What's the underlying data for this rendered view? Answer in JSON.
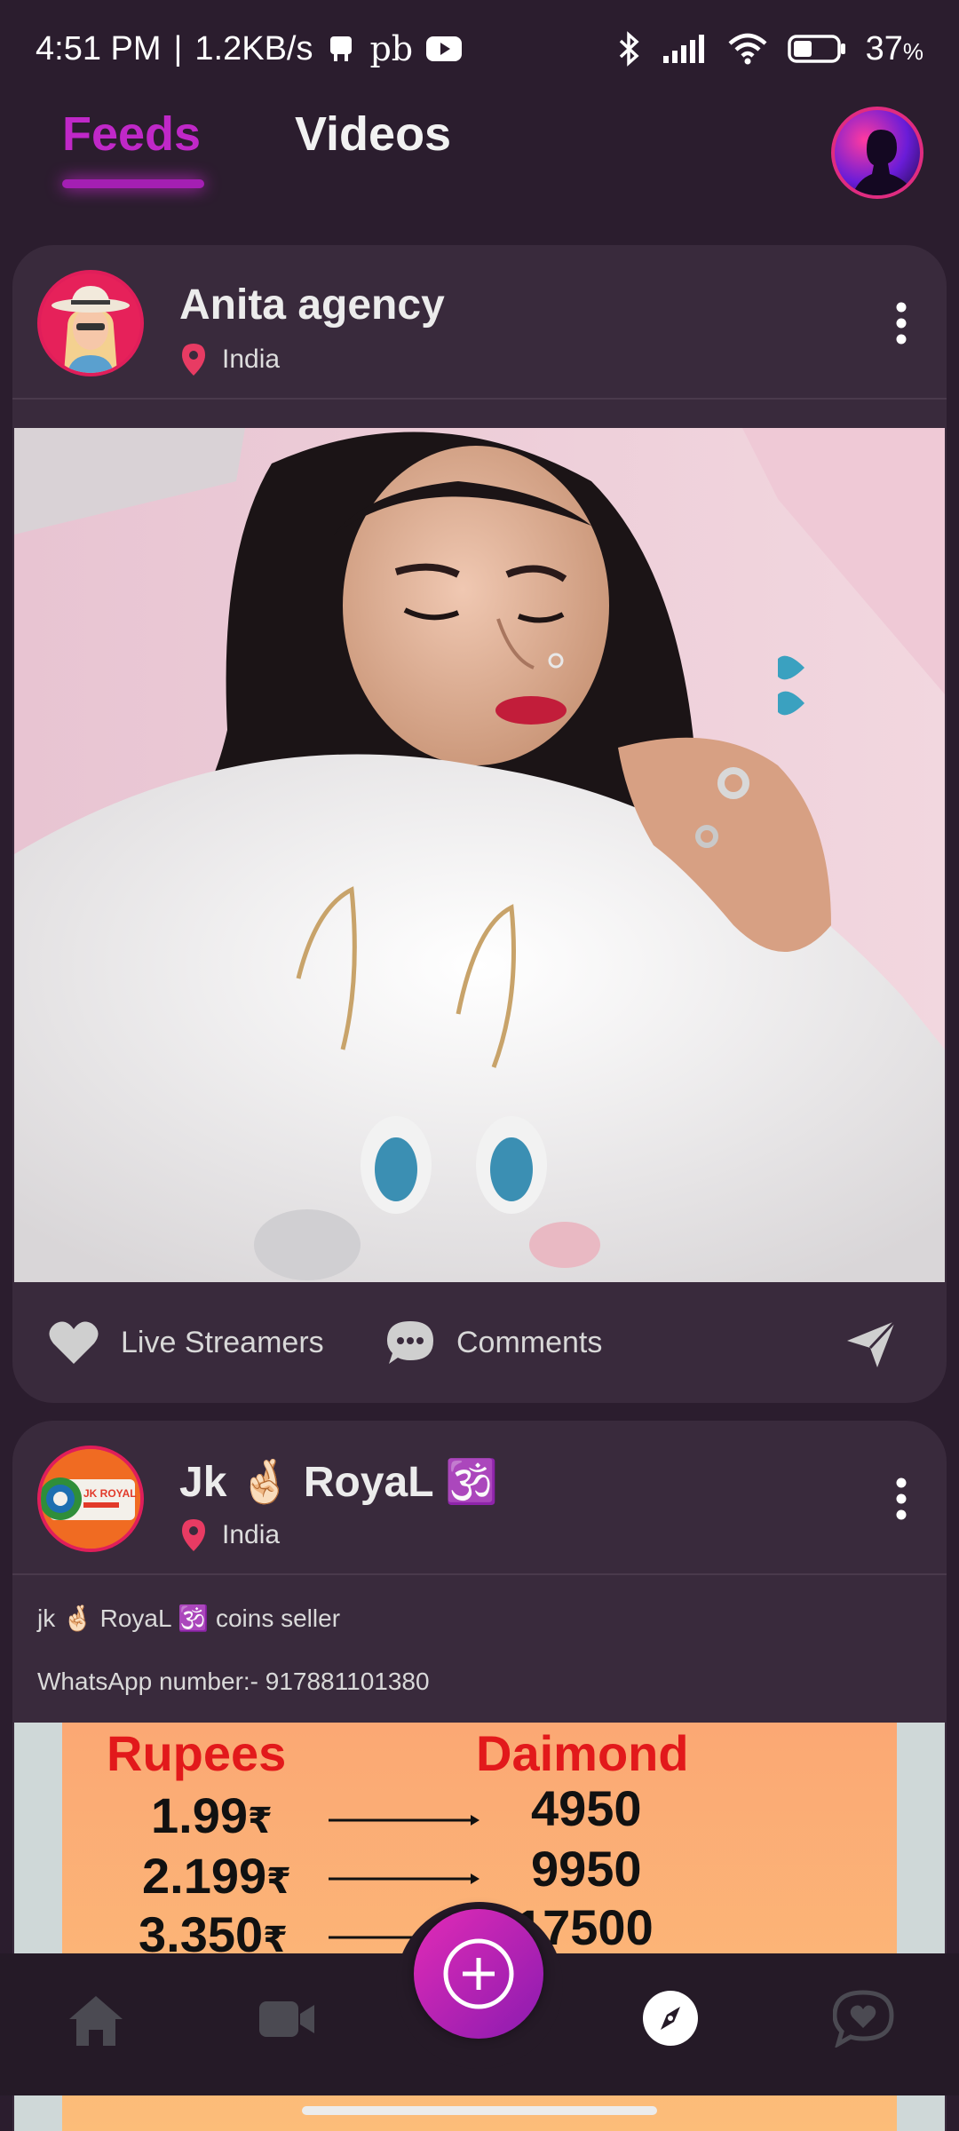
{
  "status": {
    "time": "4:51 PM",
    "separator": "|",
    "speed": "1.2KB/s",
    "pb": "pb",
    "battery": "37",
    "battery_unit": "%"
  },
  "tabs": [
    {
      "label": "Feeds",
      "active": true
    },
    {
      "label": "Videos",
      "active": false
    }
  ],
  "posts": [
    {
      "name": "Anita agency",
      "location": "India",
      "actions": {
        "likes_label": "Live Streamers",
        "comments_label": "Comments"
      }
    },
    {
      "name": "Jk 🤞🏻 RoyaL 🕉️",
      "location": "India",
      "description": [
        "jk 🤞🏻 RoyaL 🕉️ coins seller",
        "WhatsApp number:- 917881101380"
      ],
      "avatar_text": "JK ROYAL",
      "promo": {
        "header_left": "Rupees",
        "header_right": "Daimond",
        "rows": [
          {
            "rupees": "1.99",
            "currency": "₹",
            "diamond": "4950"
          },
          {
            "rupees": "2.199",
            "currency": "₹",
            "diamond": "9950"
          },
          {
            "rupees": "3.350",
            "currency": "₹",
            "diamond": "17500"
          }
        ]
      }
    }
  ],
  "nav": {
    "items": [
      "home-icon",
      "video-icon",
      "add-icon",
      "explore-icon",
      "chat-heart-icon"
    ],
    "active": "explore-icon"
  },
  "colors": {
    "accent": "#c028c8",
    "pin": "#e83b63",
    "bg": "#2b1d2e",
    "card": "#392a3c"
  }
}
